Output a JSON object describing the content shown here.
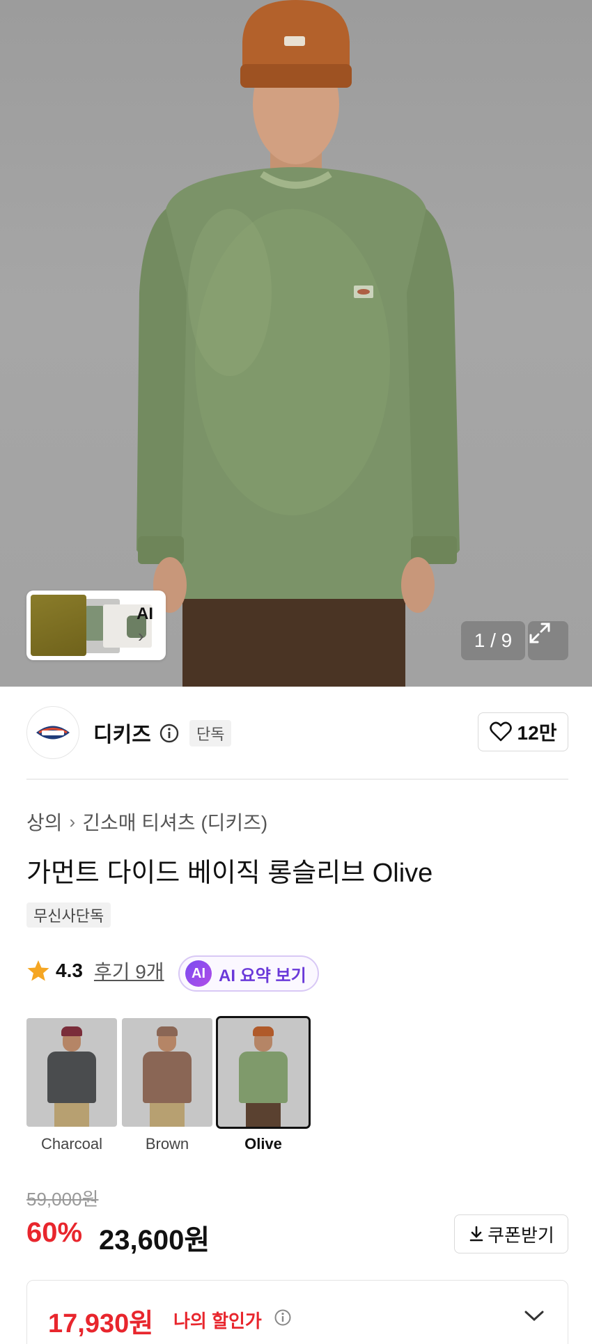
{
  "gallery": {
    "ai_thumb_label": "AI",
    "counter": "1 / 9"
  },
  "brand": {
    "name": "디키즈",
    "badge": "단독",
    "likes": "12만"
  },
  "product": {
    "breadcrumb": [
      "상의",
      "긴소매 티셔츠 (디키즈)"
    ],
    "title": "가먼트 다이드 베이직 롱슬리브 Olive",
    "exclusive_badge": "무신사단독",
    "rating": "4.3",
    "reviews_label": "후기 9개",
    "ai_summary": {
      "chip": "AI",
      "label": "AI 요약 보기"
    }
  },
  "colors": {
    "options": [
      {
        "label": "Charcoal",
        "selected": false,
        "shirt": "#4a4c4e",
        "hat": "#7a2d3a",
        "pants": "#b7a071"
      },
      {
        "label": "Brown",
        "selected": false,
        "shirt": "#8a6655",
        "hat": "#8a6655",
        "pants": "#b7a071"
      },
      {
        "label": "Olive",
        "selected": true,
        "shirt": "#7f9a6b",
        "hat": "#b05a2a",
        "pants": "#5a4130"
      }
    ]
  },
  "price": {
    "original": "59,000원",
    "discount": "60%",
    "sale": "23,600원",
    "coupon_label": "쿠폰받기",
    "my_price": "17,930원",
    "my_price_label": "나의 할인가"
  },
  "colors_theme": {
    "accent_red": "#e8262d",
    "ai_purple": "#6a39d9"
  }
}
